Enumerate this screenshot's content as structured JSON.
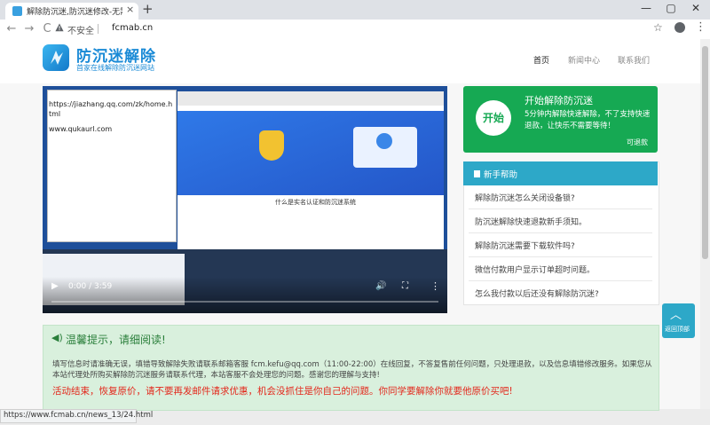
{
  "browser": {
    "tab_title": "解除防沉迷,防沉迷修改-无需二次...",
    "tab_close": "×",
    "new_tab": "+",
    "window_controls": [
      "—",
      "▢",
      "✕"
    ],
    "nav": {
      "back": "←",
      "forward": "→",
      "reload": "C"
    },
    "security_label": "不安全",
    "url": "fcmab.cn",
    "icons": [
      "lock-warning-icon",
      "star-icon",
      "profile-icon",
      "menu-dots-icon"
    ]
  },
  "header": {
    "logo_title": "防沉迷解除",
    "logo_subtitle": "首家在线解除防沉迷网站",
    "nav": [
      "首页",
      "新闻中心",
      "联系我们"
    ]
  },
  "video": {
    "note_url": "https://jiazhang.qq.com/zk/home.html",
    "note_site": "www.qukaurl.com",
    "inner_heading": "什么是实名认证和防沉迷系统",
    "time": "0:00 / 3:59",
    "progress": 0
  },
  "start_card": {
    "button": "开始",
    "title": "开始解除防沉迷",
    "desc": "5分钟内解除快速解除，不了支持快速退款，让快乐不需要等待！",
    "refund": "可退款"
  },
  "help": {
    "title": "新手帮助",
    "items": [
      "解除防沉迷怎么关闭设备锁?",
      "防沉迷解除快速退款新手须知。",
      "解除防沉迷需要下载软件吗?",
      "微信付款用户显示订单超时问题。",
      "怎么我付款以后还没有解除防沉迷?"
    ]
  },
  "back_to_top": {
    "arrow": "︿",
    "label": "返回顶部"
  },
  "notice": {
    "title": "温馨提示，请细阅读!",
    "body": "填写信息时请准确无误，填错导致解除失败请联系邮箱客服 fcm.kefu@qq.com（11:00-22:00）在线回复，不答复售前任何问题，只处理退款，以及信息填错修改服务。如果您从本站代理处所购买解除防沉迷服务请联系代理，本站客服不会处理您的问题。感谢您的理解与支持!",
    "highlight": "活动结束，恢复原价，请不要再发邮件请求优惠，机会没抓住是你自己的问题。你同学要解除你就要他原价买吧!"
  },
  "status_bar": "https://www.fcmab.cn/news_13/24.html",
  "colors": {
    "brand": "#1a8ad6",
    "start_green": "#16a953",
    "help_teal": "#2da8c8",
    "notice_red": "#e3281c"
  }
}
